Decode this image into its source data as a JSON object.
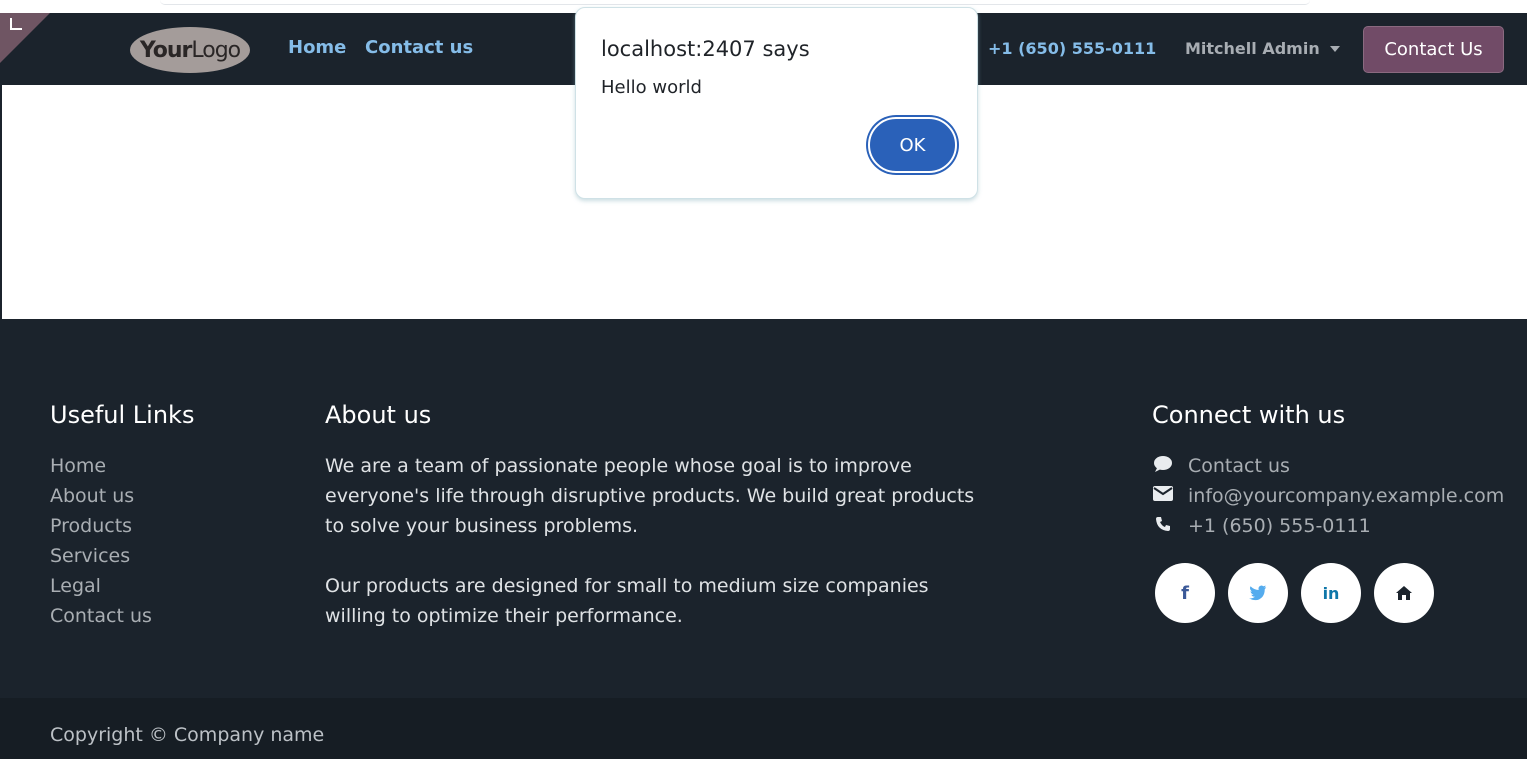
{
  "navbar": {
    "logo": {
      "bold": "Your",
      "light": "Logo"
    },
    "links": [
      {
        "label": "Home"
      },
      {
        "label": "Contact us"
      }
    ],
    "phone": "+1 (650) 555-0111",
    "user": "Mitchell Admin",
    "cta": "Contact Us",
    "colors": {
      "bg": "#1b232c",
      "link": "#85bce8",
      "cta": "#714b67"
    }
  },
  "dialog": {
    "title": "localhost:2407 says",
    "message": "Hello world",
    "ok": "OK",
    "colors": {
      "ok": "#2a61b9"
    }
  },
  "footer": {
    "useful_links": {
      "heading": "Useful Links",
      "items": [
        "Home",
        "About us",
        "Products",
        "Services",
        "Legal",
        "Contact us"
      ]
    },
    "about": {
      "heading": "About us",
      "paragraphs": [
        "We are a team of passionate people whose goal is to improve everyone's life through disruptive products. We build great products to solve your business problems.",
        "Our products are designed for small to medium size companies willing to optimize their performance."
      ]
    },
    "connect": {
      "heading": "Connect with us",
      "items": [
        {
          "icon": "comment-icon",
          "label": "Contact us"
        },
        {
          "icon": "envelope-icon",
          "label": "info@yourcompany.example.com"
        },
        {
          "icon": "phone-icon",
          "label": "+1 (650) 555-0111"
        }
      ],
      "socials": [
        {
          "icon": "facebook-icon",
          "glyph": "f",
          "color": "#3b5998"
        },
        {
          "icon": "twitter-icon",
          "glyph": "🐦",
          "color": "#55acee"
        },
        {
          "icon": "linkedin-icon",
          "glyph": "in",
          "color": "#0e76a8"
        },
        {
          "icon": "home-icon",
          "glyph": "⌂",
          "color": "#1b232c"
        }
      ]
    },
    "copyright": "Copyright © Company name"
  }
}
